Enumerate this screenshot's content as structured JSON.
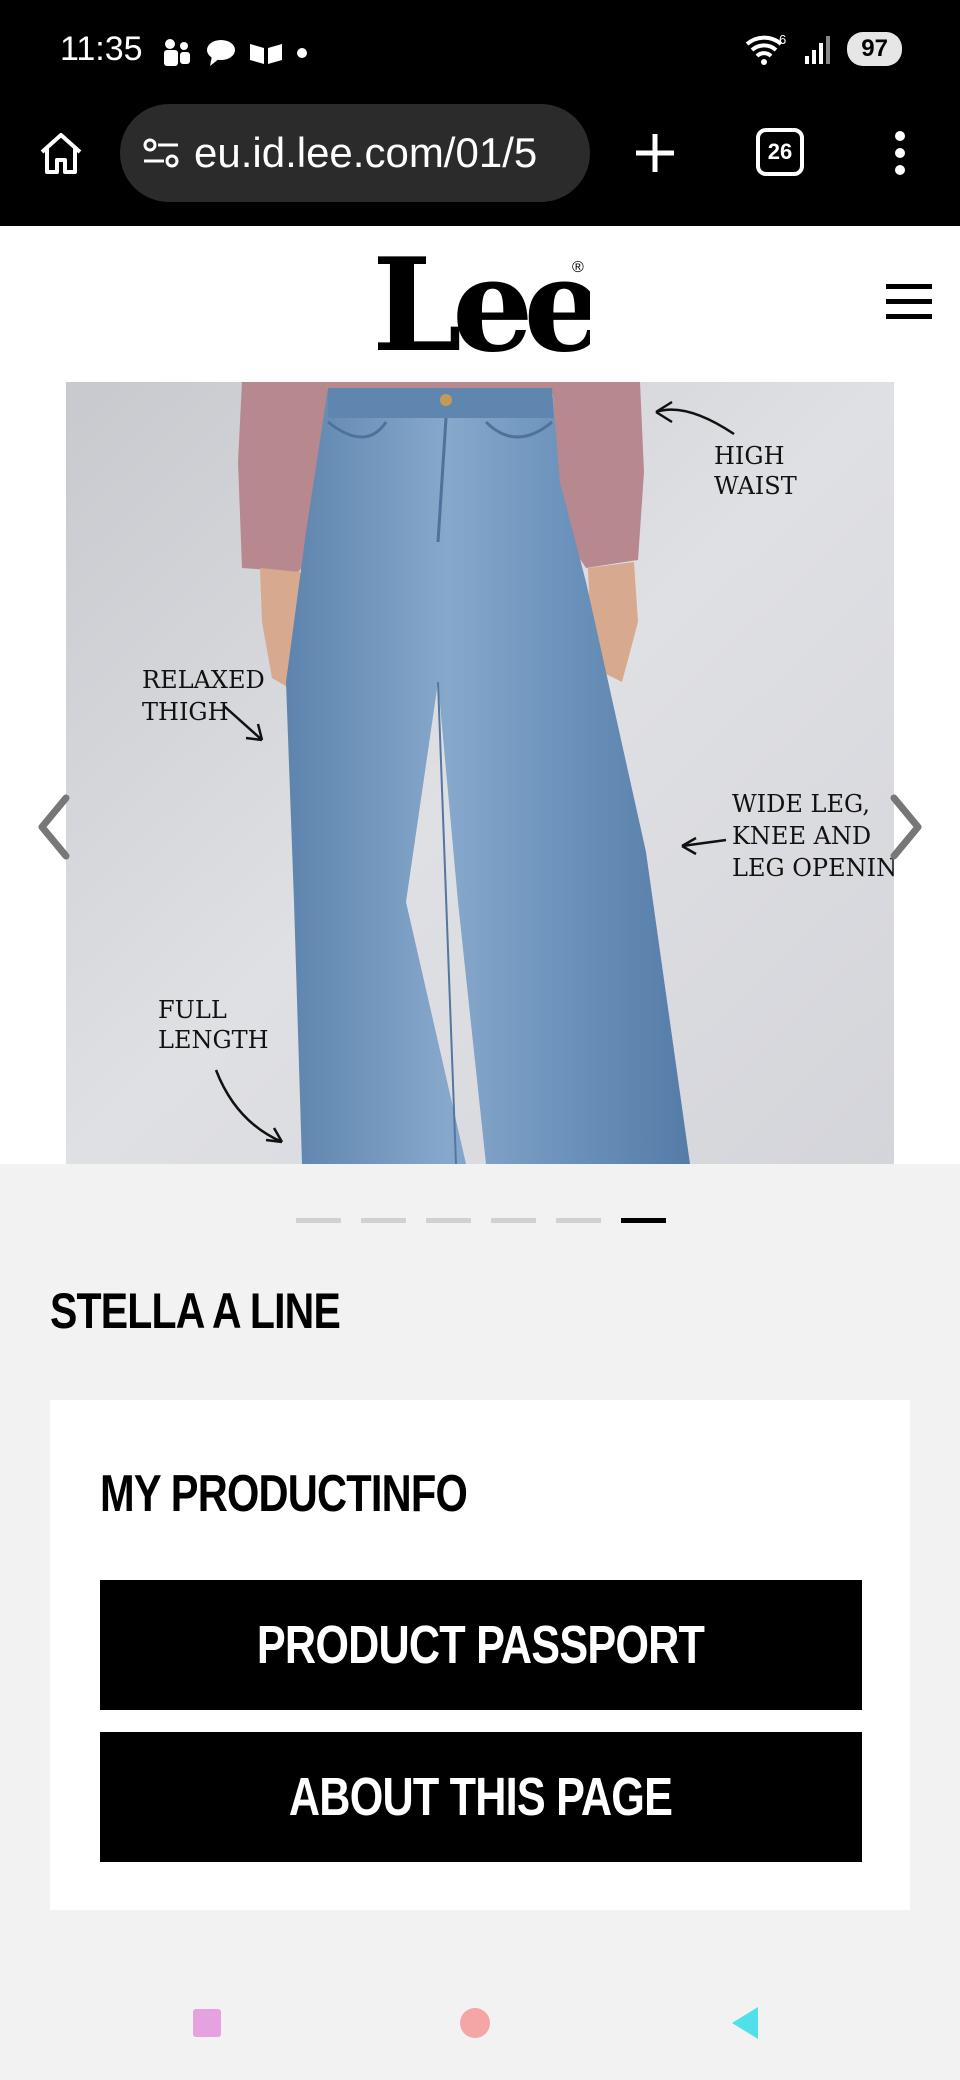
{
  "status_bar": {
    "time": "11:35",
    "network_superscript": "6",
    "battery": "97"
  },
  "browser": {
    "url": "eu.id.lee.com/01/5",
    "tab_count": "26"
  },
  "brand": {
    "logo_text": "Lee",
    "registered_mark": "®"
  },
  "gallery": {
    "annotations": {
      "high_waist": [
        "HIGH",
        "WAIST"
      ],
      "relaxed_thigh": [
        "RELAXED",
        "THIGH"
      ],
      "wide_leg": [
        "WIDE LEG,",
        "KNEE AND",
        "LEG OPENING"
      ],
      "full_length": [
        "FULL",
        "LENGTH"
      ]
    },
    "slide_count": 6,
    "active_slide": 6
  },
  "product": {
    "title": "STELLA A LINE"
  },
  "product_info": {
    "title": "MY PRODUCTINFO",
    "passport_button": "PRODUCT PASSPORT",
    "about_button": "ABOUT THIS PAGE"
  },
  "colors": {
    "accent": "#000000",
    "background": "#f2f2f2",
    "denim": "#6f95bd",
    "sweater": "#b7888e"
  }
}
